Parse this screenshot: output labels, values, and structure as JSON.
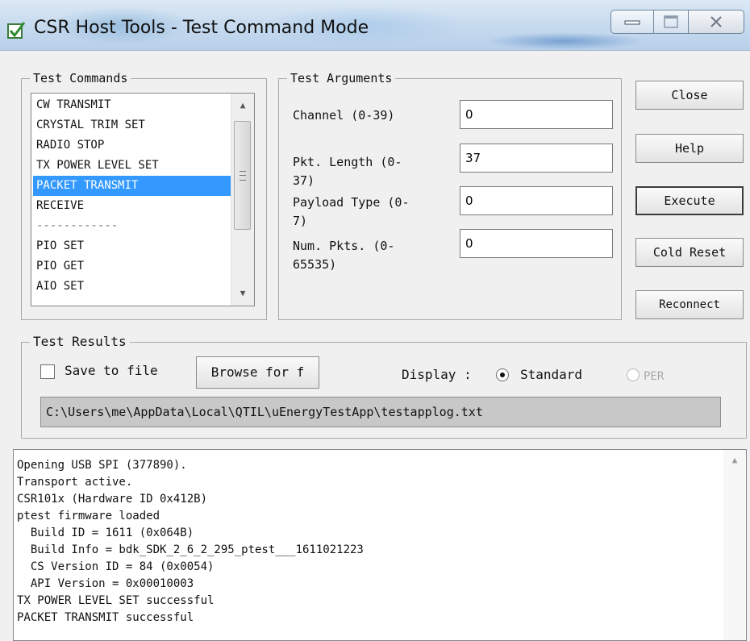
{
  "window": {
    "title": "CSR Host Tools - Test Command Mode",
    "icon": "checkbox-app-icon",
    "controls": [
      "minimize-icon",
      "maximize-icon",
      "close-icon"
    ]
  },
  "test_commands": {
    "label": "Test Commands",
    "items": [
      "CW TRANSMIT",
      "CRYSTAL TRIM SET",
      "RADIO STOP",
      "TX POWER LEVEL SET",
      "PACKET TRANSMIT",
      "RECEIVE",
      "------------",
      "PIO SET",
      "PIO GET",
      "AIO SET"
    ],
    "selected": "PACKET TRANSMIT"
  },
  "test_arguments": {
    "label": "Test Arguments",
    "fields": [
      {
        "label": "Channel (0-39)",
        "value": "0"
      },
      {
        "label": "Pkt. Length (0-\n37)",
        "value": "37"
      },
      {
        "label": "Payload Type (0-\n7)",
        "value": "0"
      },
      {
        "label": "Num. Pkts. (0-\n65535)",
        "value": "0"
      }
    ]
  },
  "buttons": {
    "close": "Close",
    "help": "Help",
    "execute": "Execute",
    "cold_reset": "Cold Reset",
    "reconnect": "Reconnect"
  },
  "test_results": {
    "label": "Test Results",
    "save_to_file": "Save to file",
    "save_checked": false,
    "browse": "Browse for f",
    "display_label": "Display :",
    "radio_standard": "Standard",
    "radio_per": "PER",
    "selected_display": "Standard",
    "file_path": "C:\\Users\\me\\AppData\\Local\\QTIL\\uEnergyTestApp\\testapplog.txt"
  },
  "log": {
    "lines": [
      "Opening USB SPI (377890).",
      "Transport active.",
      "CSR101x (Hardware ID 0x412B)",
      "ptest firmware loaded",
      "  Build ID = 1611 (0x064B)",
      "  Build Info = bdk_SDK_2_6_2_295_ptest___1611021223",
      "  CS Version ID = 84 (0x0054)",
      "  API Version = 0x00010003",
      "TX POWER LEVEL SET successful",
      "PACKET TRANSMIT successful"
    ]
  },
  "colors": {
    "selection": "#3399ff",
    "window_bg": "#f0f0f0",
    "titlebar": "#c9dcef"
  }
}
